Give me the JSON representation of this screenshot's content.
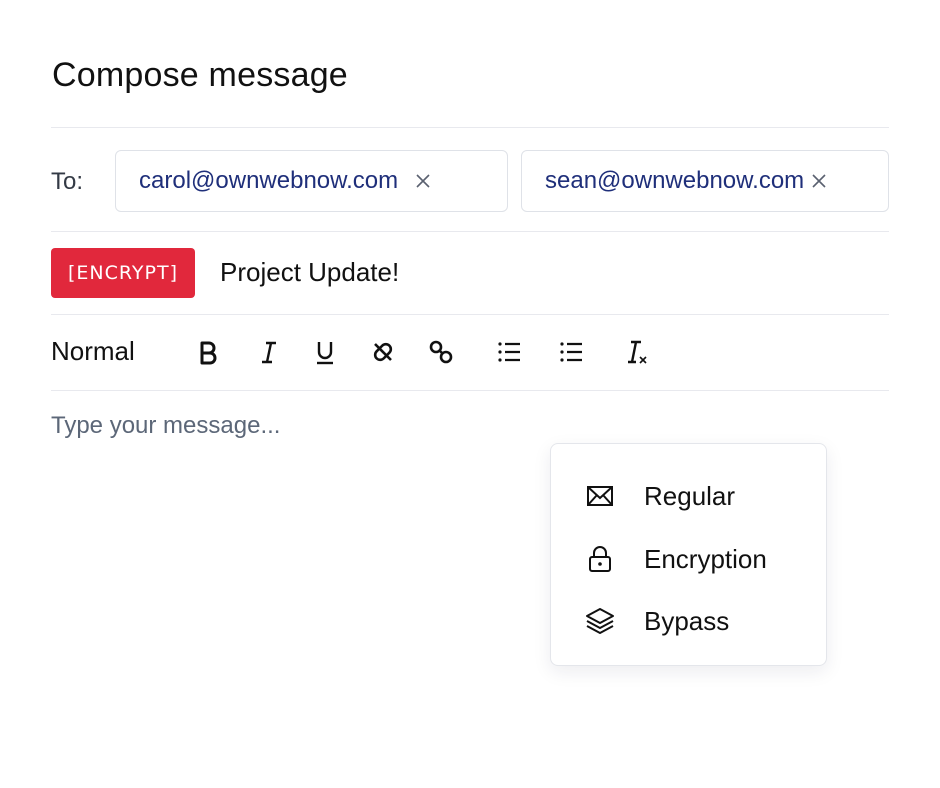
{
  "compose": {
    "title": "Compose message",
    "to_label": "To:",
    "recipients": [
      {
        "email": "carol@ownwebnow.com"
      },
      {
        "email": "sean@ownwebnow.com"
      }
    ],
    "subject_tag": "[ENCRYPT]",
    "subject": "Project Update!",
    "body_placeholder": "Type your message..."
  },
  "toolbar": {
    "format": "Normal",
    "buttons": [
      "bold-icon",
      "italic-icon",
      "underline-icon",
      "strikethrough-icon",
      "link-icon",
      "ordered-list-icon",
      "bullet-list-icon",
      "clear-format-icon"
    ]
  },
  "send_menu": {
    "items": [
      {
        "label": "Regular",
        "icon": "envelope-icon"
      },
      {
        "label": "Encryption",
        "icon": "lock-icon"
      },
      {
        "label": "Bypass",
        "icon": "layers-icon"
      }
    ]
  },
  "colors": {
    "accent_red": "#e1283c",
    "recipient_text": "#1f2f7a",
    "divider": "#e8e9ee"
  }
}
